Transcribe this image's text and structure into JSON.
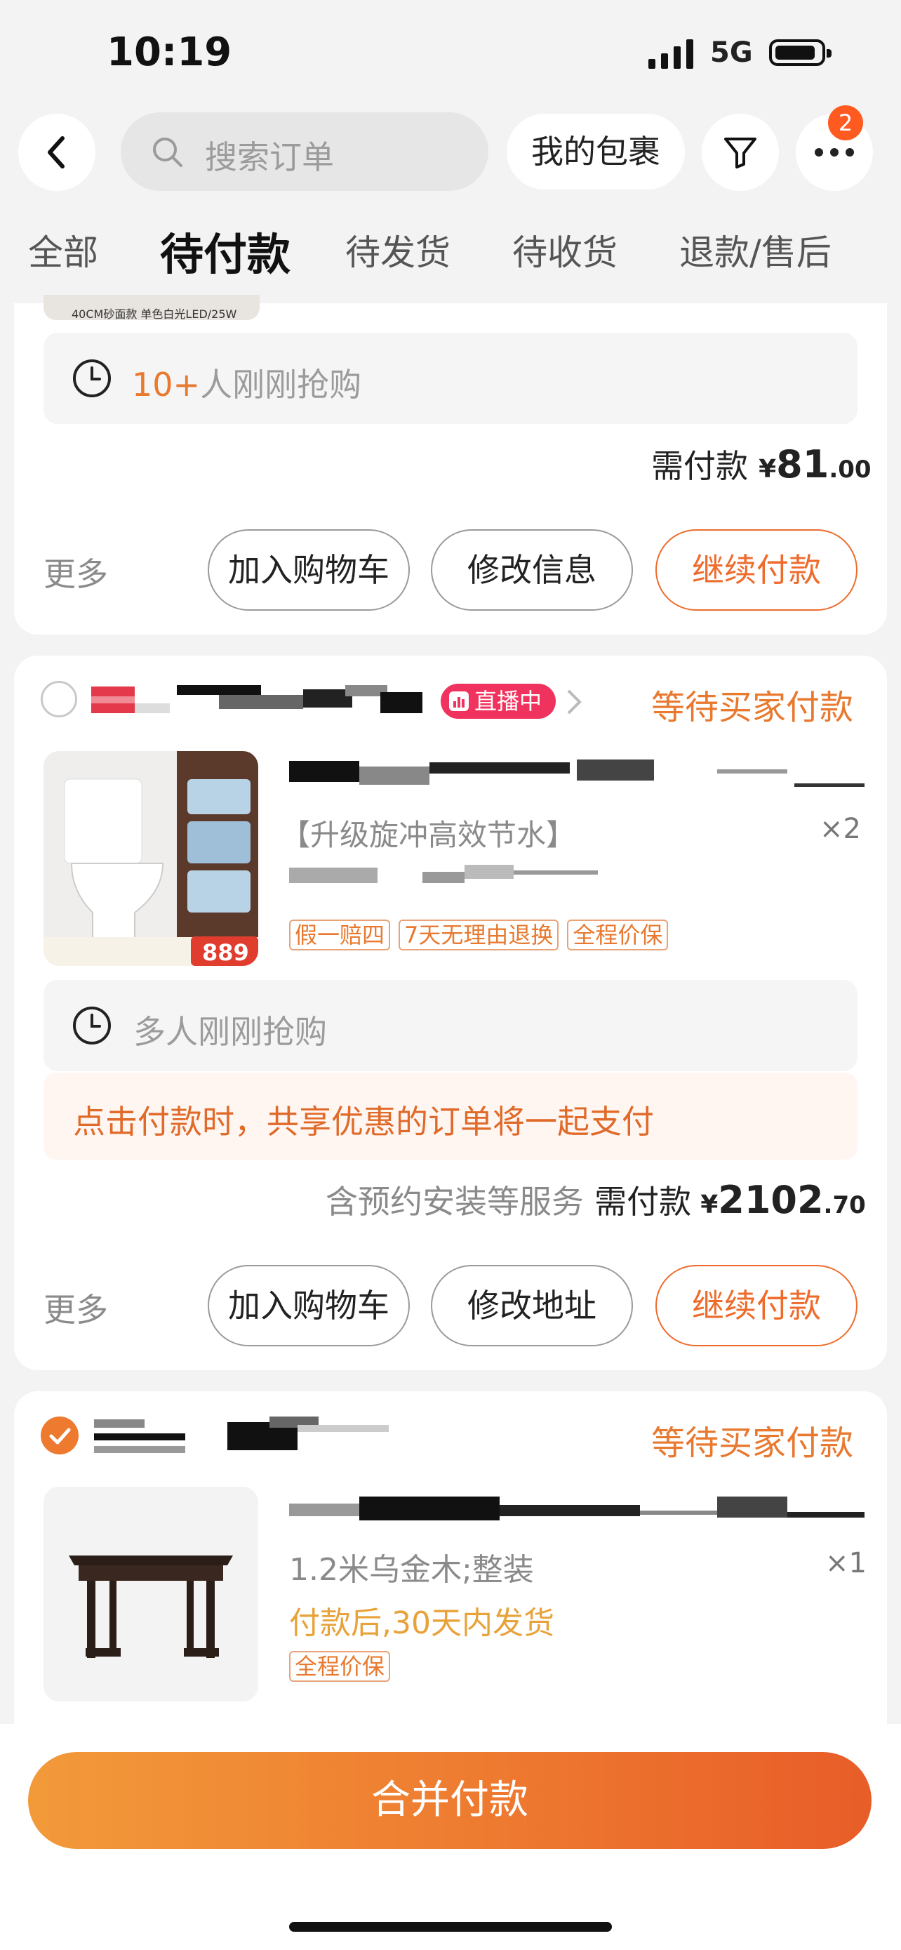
{
  "status_bar": {
    "time": "10:19",
    "network": "5G"
  },
  "header": {
    "search_placeholder": "搜索订单",
    "my_packages": "我的包裹",
    "more_badge_count": "2"
  },
  "tabs": [
    {
      "label": "全部"
    },
    {
      "label": "待付款",
      "active": true
    },
    {
      "label": "待发货"
    },
    {
      "label": "待收货"
    },
    {
      "label": "退款/售后"
    }
  ],
  "order1": {
    "snapshot_caption": "40CM砂面款 单色白光LED/25W",
    "promo_count": "10+",
    "promo_text": "人刚刚抢购",
    "price_label": "需付款",
    "currency": "¥",
    "price_int": "81",
    "price_dec": ".00",
    "more": "更多",
    "btn_cart": "加入购物车",
    "btn_edit": "修改信息",
    "btn_pay": "继续付款"
  },
  "order2": {
    "live_label": "直播中",
    "status": "等待买家付款",
    "product_subtitle": "【升级旋冲高效节水】",
    "quantity": "×2",
    "tags": [
      "假一赔四",
      "7天无理由退换",
      "全程价保"
    ],
    "thumb_price": "889",
    "promo_text": "多人刚刚抢购",
    "share_notice": "点击付款时，共享优惠的订单将一起支付",
    "service_note": "含预约安装等服务",
    "price_label": "需付款",
    "currency": "¥",
    "price_int": "2102",
    "price_dec": ".70",
    "more": "更多",
    "btn_cart": "加入购物车",
    "btn_edit": "修改地址",
    "btn_pay": "继续付款"
  },
  "order3": {
    "status": "等待买家付款",
    "spec": "1.2米乌金木;整装",
    "quantity": "×1",
    "ship_note": "付款后,30天内发货",
    "tags": [
      "全程价保"
    ]
  },
  "bottom": {
    "merge_pay": "合并付款"
  },
  "colors": {
    "accent": "#e8792f",
    "live": "#f0335e"
  }
}
